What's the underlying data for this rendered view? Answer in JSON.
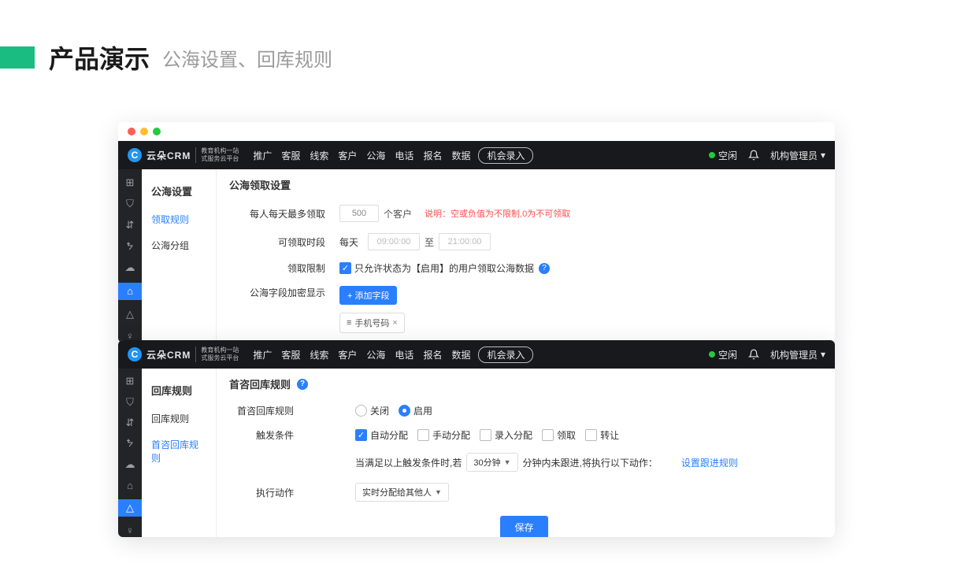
{
  "slide": {
    "title": "产品演示",
    "subtitle": "公海设置、回库规则"
  },
  "top": {
    "logo_text": "云朵CRM",
    "logo_sub1": "教育机构一站",
    "logo_sub2": "式服务云平台",
    "nav": {
      "n1": "推广",
      "n2": "客服",
      "n3": "线索",
      "n4": "客户",
      "n5": "公海",
      "n6": "电话",
      "n7": "报名",
      "n8": "数据"
    },
    "pill": "机会录入",
    "status": "空闲",
    "user": "机构管理员"
  },
  "shotA": {
    "sidebar_head": "公海设置",
    "sb1": "领取规则",
    "sb2": "公海分组",
    "title": "公海领取设置",
    "row1_label": "每人每天最多领取",
    "row1_value": "500",
    "row1_unit": "个客户",
    "row1_note": "说明：空或负值为不限制,0为不可领取",
    "row2_label": "可领取时段",
    "row2_daily": "每天",
    "row2_from": "09:00:00",
    "row2_to_word": "至",
    "row2_to": "21:00:00",
    "row3_label": "领取限制",
    "row3_chk": "只允许状态为【启用】的用户领取公海数据",
    "row4_label": "公海字段加密显示",
    "row4_btn": "+ 添加字段",
    "tag_text": "手机号码",
    "tag_prefix": "≡",
    "tag_close": "×"
  },
  "shotB": {
    "sidebar_head": "回库规则",
    "sb1": "回库规则",
    "sb2": "首咨回库规则",
    "title": "首咨回库规则",
    "row1_label": "首咨回库规则",
    "r_off": "关闭",
    "r_on": "启用",
    "row2_label": "触发条件",
    "c1": "自动分配",
    "c2": "手动分配",
    "c3": "录入分配",
    "c4": "领取",
    "c5": "转让",
    "row3_pre": "当满足以上触发条件时,若",
    "row3_sel": "30分钟",
    "row3_post": "分钟内未跟进,将执行以下动作：",
    "row3_link": "设置跟进规则",
    "row4_label": "执行动作",
    "row4_sel": "实时分配给其他人",
    "save": "保存"
  }
}
